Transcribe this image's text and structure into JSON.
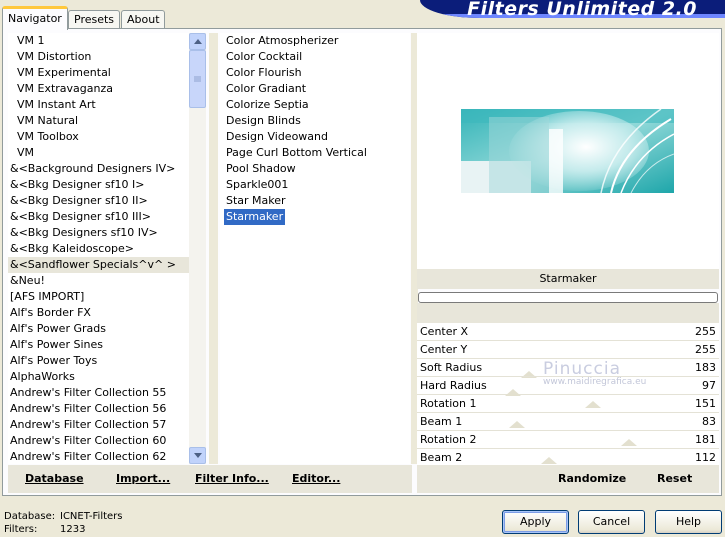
{
  "tabs": [
    "Navigator",
    "Presets",
    "About"
  ],
  "banner": {
    "title": "Filters Unlimited 2.0"
  },
  "categories": [
    {
      "label": "VM 1",
      "indent": true
    },
    {
      "label": "VM Distortion",
      "indent": true
    },
    {
      "label": "VM Experimental",
      "indent": true
    },
    {
      "label": "VM Extravaganza",
      "indent": true
    },
    {
      "label": "VM Instant Art",
      "indent": true
    },
    {
      "label": "VM Natural",
      "indent": true
    },
    {
      "label": "VM Toolbox",
      "indent": true
    },
    {
      "label": "VM",
      "indent": true
    },
    {
      "label": "&<Background Designers IV>",
      "indent": false
    },
    {
      "label": "&<Bkg Designer sf10 I>",
      "indent": false
    },
    {
      "label": "&<Bkg Designer sf10 II>",
      "indent": false
    },
    {
      "label": "&<Bkg Designer sf10 III>",
      "indent": false
    },
    {
      "label": "&<Bkg Designers sf10 IV>",
      "indent": false
    },
    {
      "label": "&<Bkg Kaleidoscope>",
      "indent": false
    },
    {
      "label": "&<Sandflower Specials^v^ >",
      "indent": false,
      "selected": true
    },
    {
      "label": "&Neu!",
      "indent": false
    },
    {
      "label": "[AFS IMPORT]",
      "indent": false
    },
    {
      "label": "Alf's Border FX",
      "indent": false
    },
    {
      "label": "Alf's Power Grads",
      "indent": false
    },
    {
      "label": "Alf's Power Sines",
      "indent": false
    },
    {
      "label": "Alf's Power Toys",
      "indent": false
    },
    {
      "label": "AlphaWorks",
      "indent": false
    },
    {
      "label": "Andrew's Filter Collection 55",
      "indent": false
    },
    {
      "label": "Andrew's Filter Collection 56",
      "indent": false
    },
    {
      "label": "Andrew's Filter Collection 57",
      "indent": false
    },
    {
      "label": "Andrew's Filter Collection 60",
      "indent": false
    },
    {
      "label": "Andrew's Filter Collection 62",
      "indent": false
    }
  ],
  "filters": [
    {
      "label": "Color Atmospherizer"
    },
    {
      "label": "Color Cocktail"
    },
    {
      "label": "Color Flourish"
    },
    {
      "label": "Color Gradiant"
    },
    {
      "label": "Colorize Septia"
    },
    {
      "label": "Design Blinds"
    },
    {
      "label": "Design Videowand"
    },
    {
      "label": "Page Curl Bottom Vertical"
    },
    {
      "label": "Pool Shadow"
    },
    {
      "label": "Sparkle001"
    },
    {
      "label": "Star Maker"
    },
    {
      "label": "Starmaker",
      "selected": true
    }
  ],
  "selected_filter": "Starmaker",
  "params": [
    {
      "name": "Center X",
      "value": "255"
    },
    {
      "name": "Center Y",
      "value": "255"
    },
    {
      "name": "Soft Radius",
      "value": "183"
    },
    {
      "name": "Hard Radius",
      "value": "97"
    },
    {
      "name": "Rotation 1",
      "value": "151"
    },
    {
      "name": "Beam 1",
      "value": "83"
    },
    {
      "name": "Rotation 2",
      "value": "181"
    },
    {
      "name": "Beam 2",
      "value": "112"
    }
  ],
  "watermark": {
    "name": "Pinuccia",
    "url": "www.maidiregrafica.eu"
  },
  "buttons_left": {
    "database": "Database",
    "import": "Import...",
    "filter_info": "Filter Info...",
    "editor": "Editor..."
  },
  "buttons_right": {
    "randomize": "Randomize",
    "reset": "Reset"
  },
  "status": {
    "database_label": "Database:",
    "database_value": "ICNET-Filters",
    "filters_label": "Filters:",
    "filters_value": "1233"
  },
  "dialog": {
    "apply": "Apply",
    "cancel": "Cancel",
    "help": "Help"
  },
  "colors": {
    "accent": "#316ac5",
    "banner": "#0b1d7a",
    "tab_highlight": "#ffc83c"
  }
}
